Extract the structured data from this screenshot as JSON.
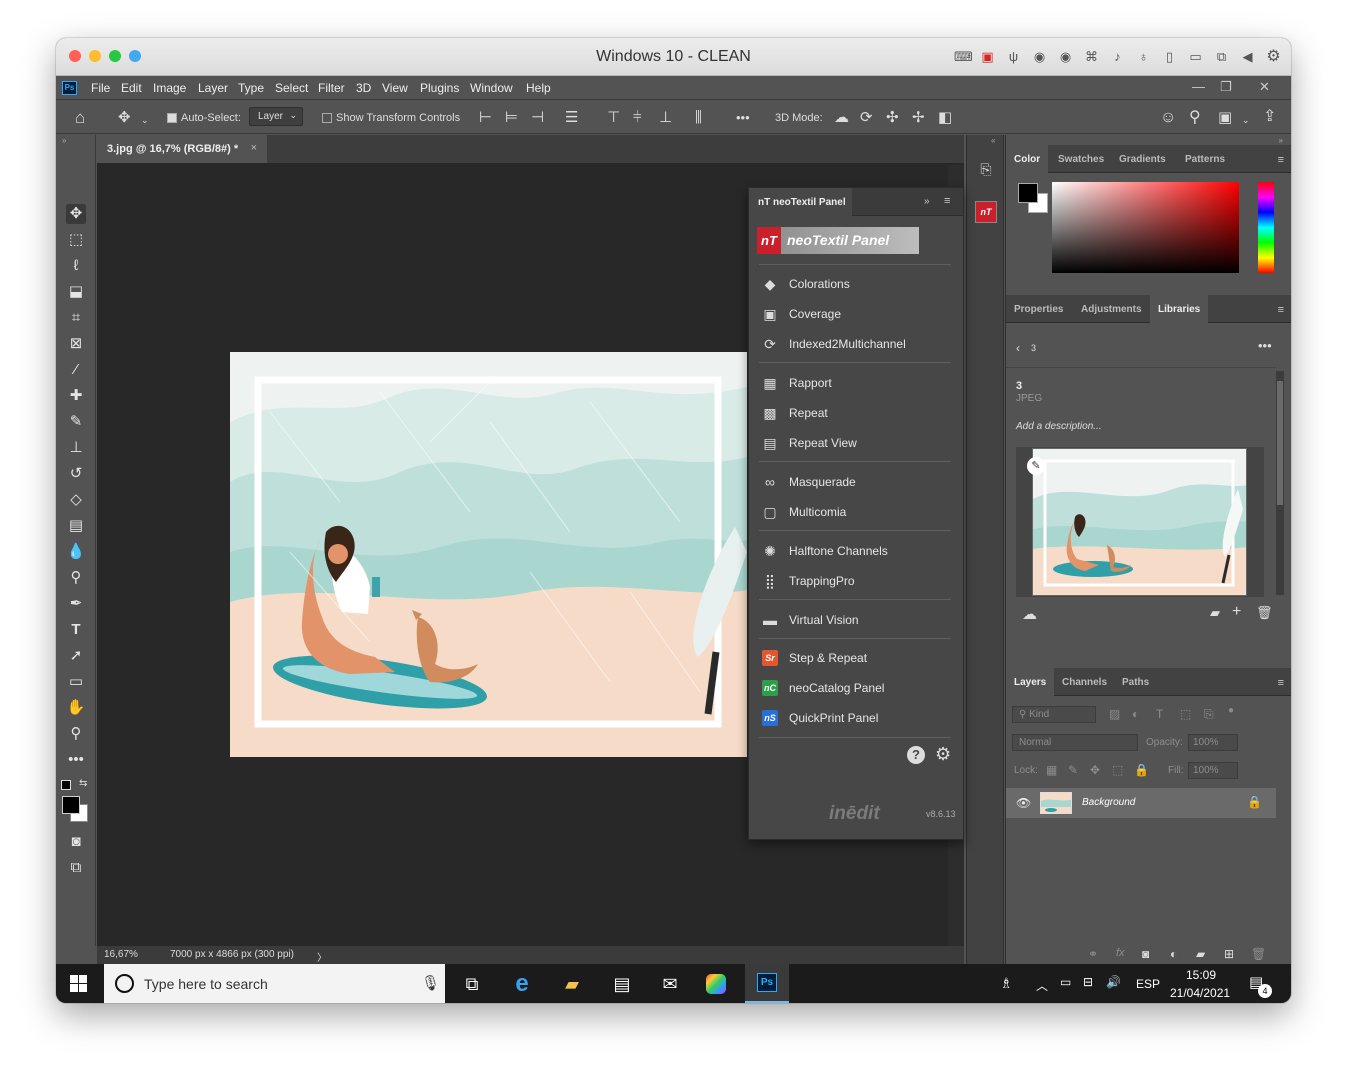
{
  "vm": {
    "title": "Windows 10 - CLEAN",
    "toolbar_icons": [
      "keyboard-icon",
      "chip-icon",
      "usb-icon",
      "cd-icon",
      "cd-icon-2",
      "network-icon",
      "audio-icon",
      "mic-icon",
      "usb-drive-icon",
      "display-icon",
      "shared-folder-icon",
      "back-icon",
      "settings-icon"
    ]
  },
  "ps_menu": {
    "items": [
      "File",
      "Edit",
      "Image",
      "Layer",
      "Type",
      "Select",
      "Filter",
      "3D",
      "View",
      "Plugins",
      "Window",
      "Help"
    ]
  },
  "options_bar": {
    "auto_select_label": "Auto-Select:",
    "auto_select_target": "Layer",
    "show_transform_label": "Show Transform Controls",
    "mode_3d_label": "3D Mode:",
    "more": "•••"
  },
  "document": {
    "tab_title": "3.jpg @ 16,7% (RGB/8#) *",
    "close": "×"
  },
  "status_bar": {
    "zoom": "16,67%",
    "dimensions": "7000 px x 4866 px (300 ppi)",
    "arrow": "〉"
  },
  "nt_panel": {
    "tab_title": "nT neoTextil Panel",
    "banner_logo": "nT",
    "banner_text": "neoTextil Panel",
    "groups": [
      {
        "items": [
          {
            "label": "Colorations",
            "icon": "colorations-icon"
          },
          {
            "label": "Coverage",
            "icon": "coverage-icon"
          },
          {
            "label": "Indexed2Multichannel",
            "icon": "refresh-icon"
          }
        ]
      },
      {
        "items": [
          {
            "label": "Rapport",
            "icon": "rapport-icon"
          },
          {
            "label": "Repeat",
            "icon": "repeat-icon"
          },
          {
            "label": "Repeat View",
            "icon": "repeat-view-icon"
          }
        ]
      },
      {
        "items": [
          {
            "label": "Masquerade",
            "icon": "mask-icon"
          },
          {
            "label": "Multicomia",
            "icon": "multicomia-icon"
          }
        ]
      },
      {
        "items": [
          {
            "label": "Halftone Channels",
            "icon": "halftone-icon"
          },
          {
            "label": "TrappingPro",
            "icon": "trapping-icon"
          }
        ]
      },
      {
        "items": [
          {
            "label": "Virtual Vision",
            "icon": "virtual-vision-icon"
          }
        ]
      },
      {
        "items": [
          {
            "label": "Step & Repeat",
            "icon": "sr-logo",
            "badge": "Sr",
            "color": "#e4572e"
          },
          {
            "label": "neoCatalog Panel",
            "icon": "nc-logo",
            "badge": "nC",
            "color": "#2e9e4a"
          },
          {
            "label": "QuickPrint Panel",
            "icon": "ns-logo",
            "badge": "nS",
            "color": "#2a6fd6"
          }
        ]
      }
    ],
    "brand": "inēdit",
    "version": "v8.6.13"
  },
  "color_panel": {
    "tabs": [
      "Color",
      "Swatches",
      "Gradients",
      "Patterns"
    ],
    "active": "Color",
    "foreground": "#000000",
    "background": "#ffffff"
  },
  "libraries_panel": {
    "tabs": [
      "Properties",
      "Adjustments",
      "Libraries"
    ],
    "active": "Libraries",
    "back_label": "3",
    "item_name": "3",
    "item_type": "JPEG",
    "description_placeholder": "Add a description..."
  },
  "layers_panel": {
    "tabs": [
      "Layers",
      "Channels",
      "Paths"
    ],
    "active": "Layers",
    "kind_placeholder": "Kind",
    "blend_mode": "Normal",
    "opacity_label": "Opacity:",
    "opacity_value": "100%",
    "lock_label": "Lock:",
    "fill_label": "Fill:",
    "fill_value": "100%",
    "layers": [
      {
        "name": "Background"
      }
    ]
  },
  "taskbar": {
    "search_placeholder": "Type here to search",
    "language": "ESP",
    "time": "15:09",
    "date": "21/04/2021",
    "notifications": "4",
    "apps": [
      {
        "name": "Ps",
        "color": "#31a8ff"
      }
    ]
  }
}
